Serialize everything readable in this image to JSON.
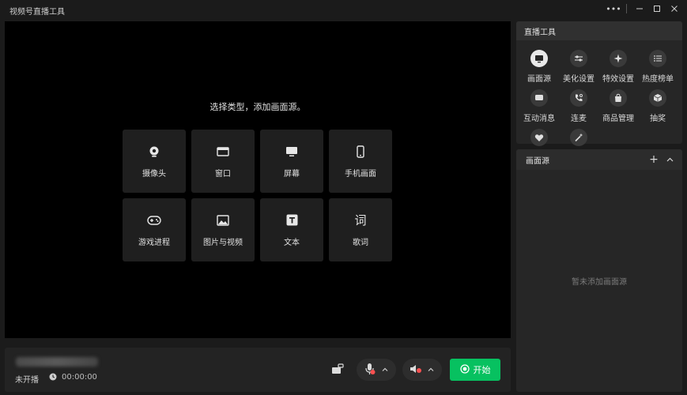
{
  "window": {
    "title": "视频号直播工具"
  },
  "preview": {
    "prompt": "选择类型，添加画面源。",
    "tiles": [
      {
        "label": "摄像头",
        "icon": "camera-icon"
      },
      {
        "label": "窗口",
        "icon": "window-icon"
      },
      {
        "label": "屏幕",
        "icon": "monitor-icon"
      },
      {
        "label": "手机画面",
        "icon": "phone-icon"
      },
      {
        "label": "游戏进程",
        "icon": "gamepad-icon"
      },
      {
        "label": "图片与视频",
        "icon": "image-icon"
      },
      {
        "label": "文本",
        "icon": "text-icon"
      },
      {
        "label": "歌词",
        "icon": "lyrics-icon",
        "glyph": "词"
      }
    ]
  },
  "bottom": {
    "status": "未开播",
    "timer": "00:00:00",
    "start_label": "开始"
  },
  "tools": {
    "title": "直播工具",
    "items": [
      {
        "label": "画面源",
        "icon": "screen-source-icon"
      },
      {
        "label": "美化设置",
        "icon": "sliders-icon"
      },
      {
        "label": "特效设置",
        "icon": "sparkle-icon"
      },
      {
        "label": "热度榜单",
        "icon": "list-icon"
      },
      {
        "label": "互动消息",
        "icon": "message-icon"
      },
      {
        "label": "连麦",
        "icon": "phone-call-icon"
      },
      {
        "label": "商品管理",
        "icon": "shopping-bag-icon"
      },
      {
        "label": "抽奖",
        "icon": "gift-box-icon"
      },
      {
        "label": "",
        "icon": "heart-icon"
      },
      {
        "label": "",
        "icon": "magic-icon"
      }
    ]
  },
  "sources": {
    "title": "画面源",
    "empty": "暂未添加画面源"
  },
  "colors": {
    "accent": "#07c160",
    "bg": "#1b1b1b",
    "panel": "#262626"
  }
}
